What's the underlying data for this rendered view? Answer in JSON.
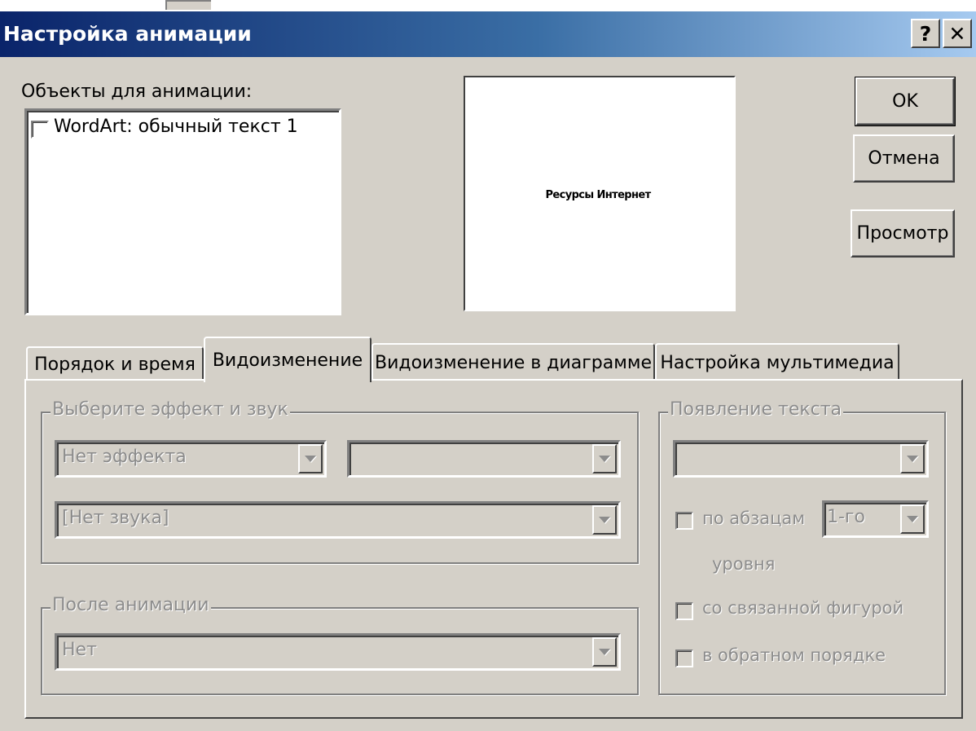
{
  "window": {
    "title": "Настройка анимации",
    "help_button": "?",
    "close_button": "✕"
  },
  "objects": {
    "label": "Объекты для анимации:",
    "items": [
      {
        "label": "WordArt: обычный текст 1",
        "checked": false
      }
    ]
  },
  "preview": {
    "text": "Ресурсы Интернет"
  },
  "buttons": {
    "ok": "OK",
    "cancel": "Отмена",
    "preview": "Просмотр"
  },
  "tabs": [
    {
      "label": "Порядок и время",
      "active": false
    },
    {
      "label": "Видоизменение",
      "active": true
    },
    {
      "label": "Видоизменение в диаграмме",
      "active": false
    },
    {
      "label": "Настройка мультимедиа",
      "active": false
    }
  ],
  "effect_group": {
    "title": "Выберите эффект и звук",
    "effect_value": "Нет эффекта",
    "direction_value": "",
    "sound_value": "[Нет звука]"
  },
  "after_group": {
    "title": "После анимации",
    "value": "Нет"
  },
  "text_group": {
    "title": "Появление текста",
    "mode_value": "",
    "by_paragraphs_label": "по абзацам",
    "level_value": "1-го",
    "level_suffix": "уровня",
    "attached_shape_label": "со связанной фигурой",
    "reverse_order_label": "в обратном порядке"
  },
  "colors": {
    "titlebar_start": "#0a246a",
    "titlebar_end": "#a6caf0",
    "face": "#d4d0c8",
    "disabled_text": "#8c8c8c"
  }
}
